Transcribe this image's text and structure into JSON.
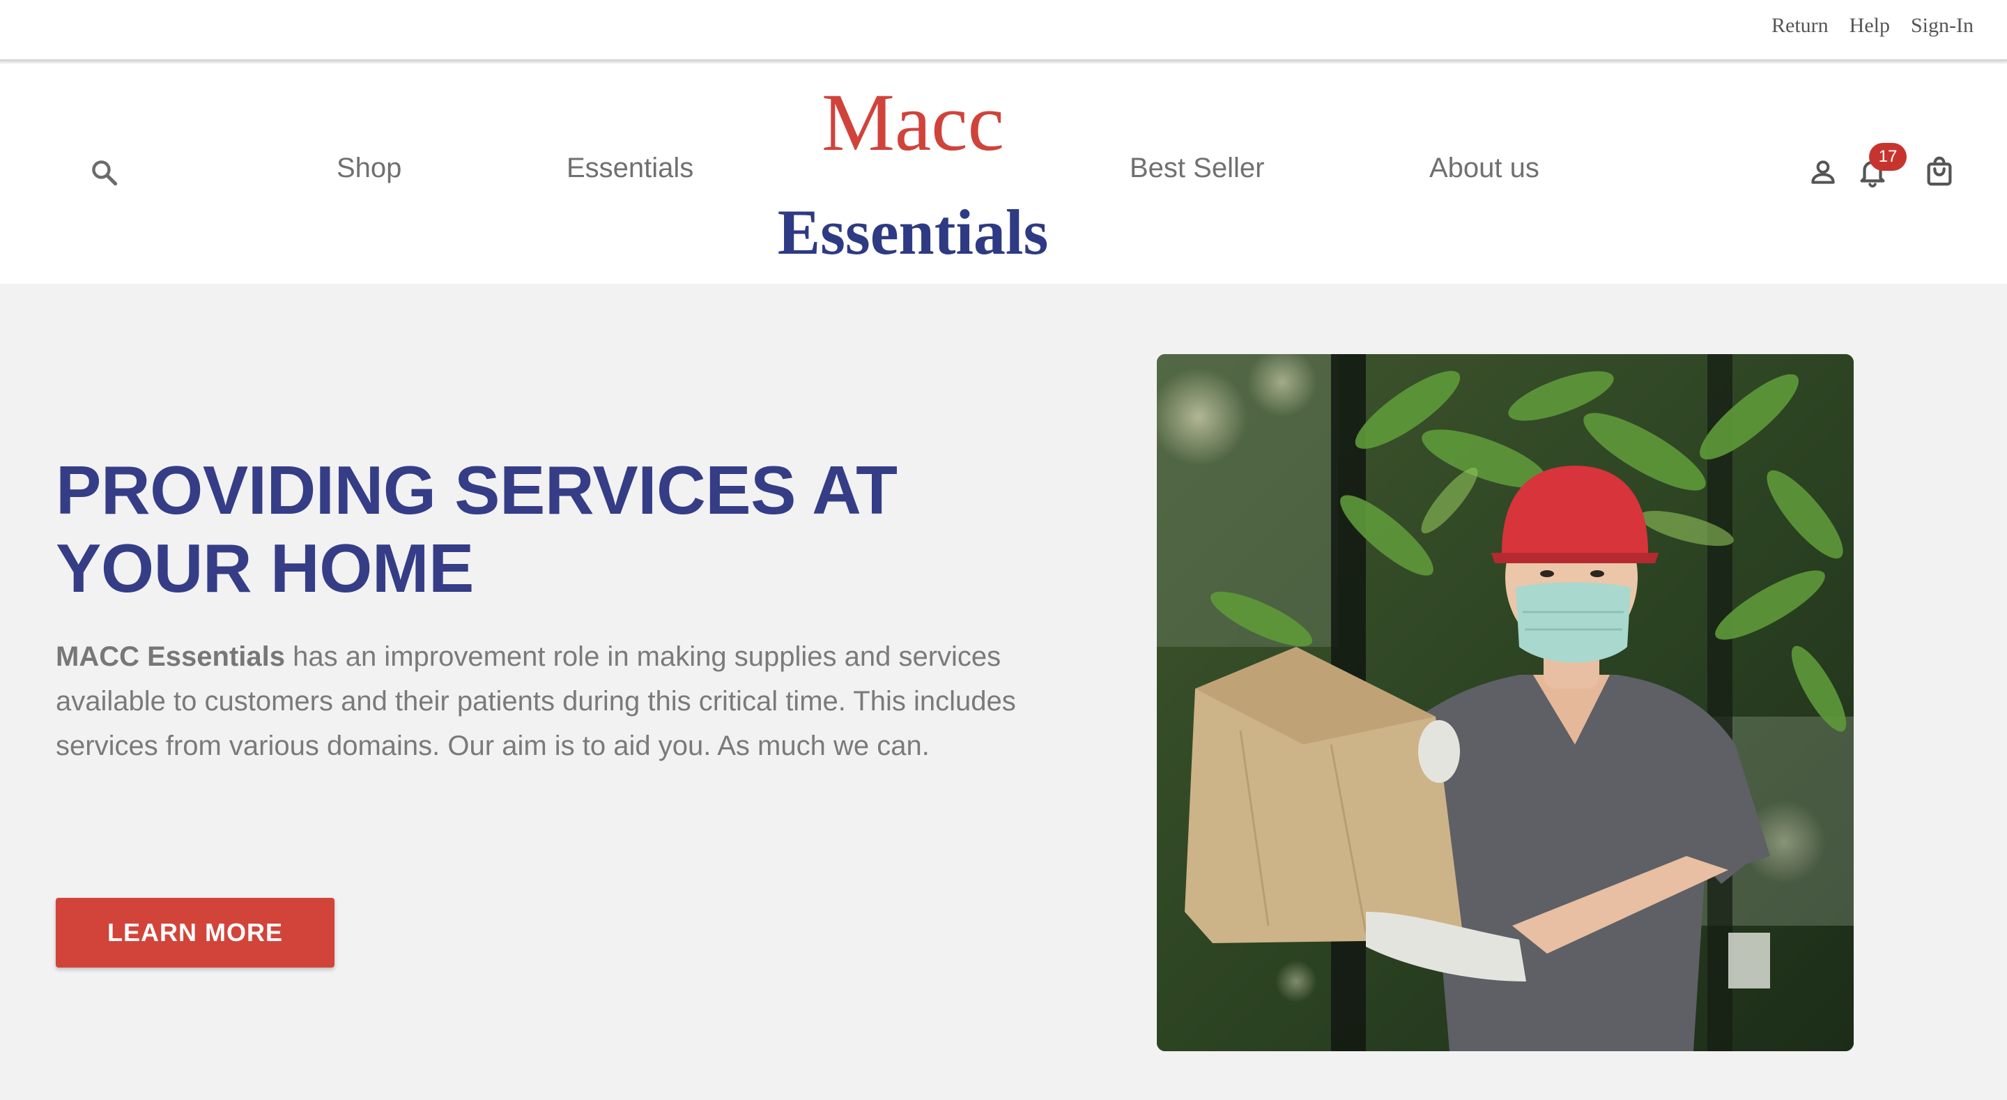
{
  "utility_nav": {
    "links": [
      "Return",
      "Help",
      "Sign-In"
    ]
  },
  "header": {
    "search_icon": "search-icon",
    "nav_left": [
      "Shop",
      "Essentials"
    ],
    "nav_right": [
      "Best Seller",
      "About us"
    ],
    "logo": {
      "line1": "Macc",
      "line2": "Essentials",
      "line1_color": "#d0433b",
      "line2_color": "#2e3a83"
    },
    "icons": {
      "account": "user-icon",
      "notifications": "bell-icon",
      "cart": "shopping-bag-icon"
    },
    "notification_count": "17"
  },
  "hero": {
    "title": "PROVIDING SERVICES AT YOUR HOME",
    "brand": "MACC Essentials",
    "body": " has an improvement role in making supplies and services available to customers and their patients during this critical time. This includes services from various domains. Our aim is to aid you. As much we can.",
    "button_label": "LEARN MORE",
    "image": "photo of a delivery man in a red cap and face mask holding a paper bag",
    "title_color": "#353d86",
    "button_color": "#d2443a"
  }
}
